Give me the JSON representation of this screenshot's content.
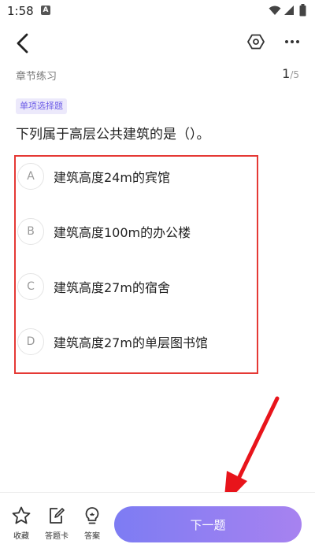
{
  "status_bar": {
    "time": "1:58",
    "notification_icon": "a-notification-icon",
    "icons": [
      "wifi-icon",
      "signal-icon",
      "battery-icon"
    ]
  },
  "nav": {
    "back_icon": "chevron-left-icon",
    "settings_icon": "hexagon-settings-icon",
    "more_icon": "more-horizontal-icon"
  },
  "section": {
    "label": "章节练习",
    "progress_current": "1",
    "progress_total": "/5"
  },
  "question": {
    "type_badge": "单项选择题",
    "text": "下列属于高层公共建筑的是（）。",
    "options": [
      {
        "letter": "A",
        "text": "建筑高度24m的宾馆"
      },
      {
        "letter": "B",
        "text": "建筑高度100m的办公楼"
      },
      {
        "letter": "C",
        "text": "建筑高度27m的宿舍"
      },
      {
        "letter": "D",
        "text": "建筑高度27m的单层图书馆"
      }
    ]
  },
  "bottom_bar": {
    "favorite_label": "收藏",
    "answer_card_label": "答题卡",
    "answer_label": "答案",
    "next_label": "下一题"
  },
  "colors": {
    "accent": "#7d7cf3",
    "accent_end": "#a782f0",
    "highlight_border": "#e53935",
    "badge_bg": "#ece9fb",
    "badge_text": "#6c5ce7"
  }
}
